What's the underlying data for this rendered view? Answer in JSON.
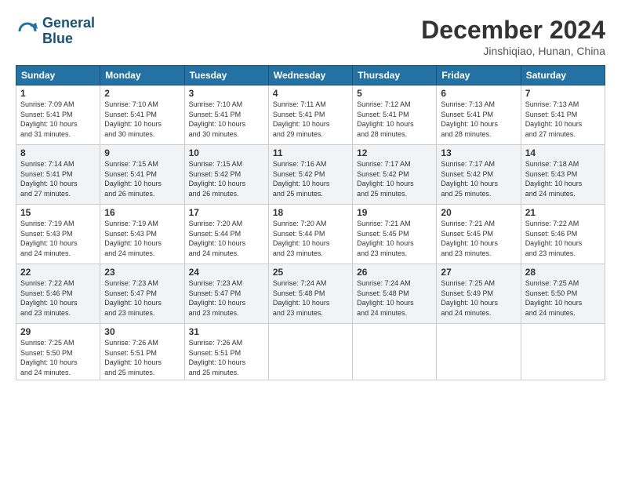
{
  "header": {
    "logo_line1": "General",
    "logo_line2": "Blue",
    "month": "December 2024",
    "location": "Jinshiqiao, Hunan, China"
  },
  "weekdays": [
    "Sunday",
    "Monday",
    "Tuesday",
    "Wednesday",
    "Thursday",
    "Friday",
    "Saturday"
  ],
  "weeks": [
    [
      {
        "day": "1",
        "info": "Sunrise: 7:09 AM\nSunset: 5:41 PM\nDaylight: 10 hours\nand 31 minutes."
      },
      {
        "day": "2",
        "info": "Sunrise: 7:10 AM\nSunset: 5:41 PM\nDaylight: 10 hours\nand 30 minutes."
      },
      {
        "day": "3",
        "info": "Sunrise: 7:10 AM\nSunset: 5:41 PM\nDaylight: 10 hours\nand 30 minutes."
      },
      {
        "day": "4",
        "info": "Sunrise: 7:11 AM\nSunset: 5:41 PM\nDaylight: 10 hours\nand 29 minutes."
      },
      {
        "day": "5",
        "info": "Sunrise: 7:12 AM\nSunset: 5:41 PM\nDaylight: 10 hours\nand 28 minutes."
      },
      {
        "day": "6",
        "info": "Sunrise: 7:13 AM\nSunset: 5:41 PM\nDaylight: 10 hours\nand 28 minutes."
      },
      {
        "day": "7",
        "info": "Sunrise: 7:13 AM\nSunset: 5:41 PM\nDaylight: 10 hours\nand 27 minutes."
      }
    ],
    [
      {
        "day": "8",
        "info": "Sunrise: 7:14 AM\nSunset: 5:41 PM\nDaylight: 10 hours\nand 27 minutes."
      },
      {
        "day": "9",
        "info": "Sunrise: 7:15 AM\nSunset: 5:41 PM\nDaylight: 10 hours\nand 26 minutes."
      },
      {
        "day": "10",
        "info": "Sunrise: 7:15 AM\nSunset: 5:42 PM\nDaylight: 10 hours\nand 26 minutes."
      },
      {
        "day": "11",
        "info": "Sunrise: 7:16 AM\nSunset: 5:42 PM\nDaylight: 10 hours\nand 25 minutes."
      },
      {
        "day": "12",
        "info": "Sunrise: 7:17 AM\nSunset: 5:42 PM\nDaylight: 10 hours\nand 25 minutes."
      },
      {
        "day": "13",
        "info": "Sunrise: 7:17 AM\nSunset: 5:42 PM\nDaylight: 10 hours\nand 25 minutes."
      },
      {
        "day": "14",
        "info": "Sunrise: 7:18 AM\nSunset: 5:43 PM\nDaylight: 10 hours\nand 24 minutes."
      }
    ],
    [
      {
        "day": "15",
        "info": "Sunrise: 7:19 AM\nSunset: 5:43 PM\nDaylight: 10 hours\nand 24 minutes."
      },
      {
        "day": "16",
        "info": "Sunrise: 7:19 AM\nSunset: 5:43 PM\nDaylight: 10 hours\nand 24 minutes."
      },
      {
        "day": "17",
        "info": "Sunrise: 7:20 AM\nSunset: 5:44 PM\nDaylight: 10 hours\nand 24 minutes."
      },
      {
        "day": "18",
        "info": "Sunrise: 7:20 AM\nSunset: 5:44 PM\nDaylight: 10 hours\nand 23 minutes."
      },
      {
        "day": "19",
        "info": "Sunrise: 7:21 AM\nSunset: 5:45 PM\nDaylight: 10 hours\nand 23 minutes."
      },
      {
        "day": "20",
        "info": "Sunrise: 7:21 AM\nSunset: 5:45 PM\nDaylight: 10 hours\nand 23 minutes."
      },
      {
        "day": "21",
        "info": "Sunrise: 7:22 AM\nSunset: 5:46 PM\nDaylight: 10 hours\nand 23 minutes."
      }
    ],
    [
      {
        "day": "22",
        "info": "Sunrise: 7:22 AM\nSunset: 5:46 PM\nDaylight: 10 hours\nand 23 minutes."
      },
      {
        "day": "23",
        "info": "Sunrise: 7:23 AM\nSunset: 5:47 PM\nDaylight: 10 hours\nand 23 minutes."
      },
      {
        "day": "24",
        "info": "Sunrise: 7:23 AM\nSunset: 5:47 PM\nDaylight: 10 hours\nand 23 minutes."
      },
      {
        "day": "25",
        "info": "Sunrise: 7:24 AM\nSunset: 5:48 PM\nDaylight: 10 hours\nand 23 minutes."
      },
      {
        "day": "26",
        "info": "Sunrise: 7:24 AM\nSunset: 5:48 PM\nDaylight: 10 hours\nand 24 minutes."
      },
      {
        "day": "27",
        "info": "Sunrise: 7:25 AM\nSunset: 5:49 PM\nDaylight: 10 hours\nand 24 minutes."
      },
      {
        "day": "28",
        "info": "Sunrise: 7:25 AM\nSunset: 5:50 PM\nDaylight: 10 hours\nand 24 minutes."
      }
    ],
    [
      {
        "day": "29",
        "info": "Sunrise: 7:25 AM\nSunset: 5:50 PM\nDaylight: 10 hours\nand 24 minutes."
      },
      {
        "day": "30",
        "info": "Sunrise: 7:26 AM\nSunset: 5:51 PM\nDaylight: 10 hours\nand 25 minutes."
      },
      {
        "day": "31",
        "info": "Sunrise: 7:26 AM\nSunset: 5:51 PM\nDaylight: 10 hours\nand 25 minutes."
      },
      null,
      null,
      null,
      null
    ]
  ]
}
